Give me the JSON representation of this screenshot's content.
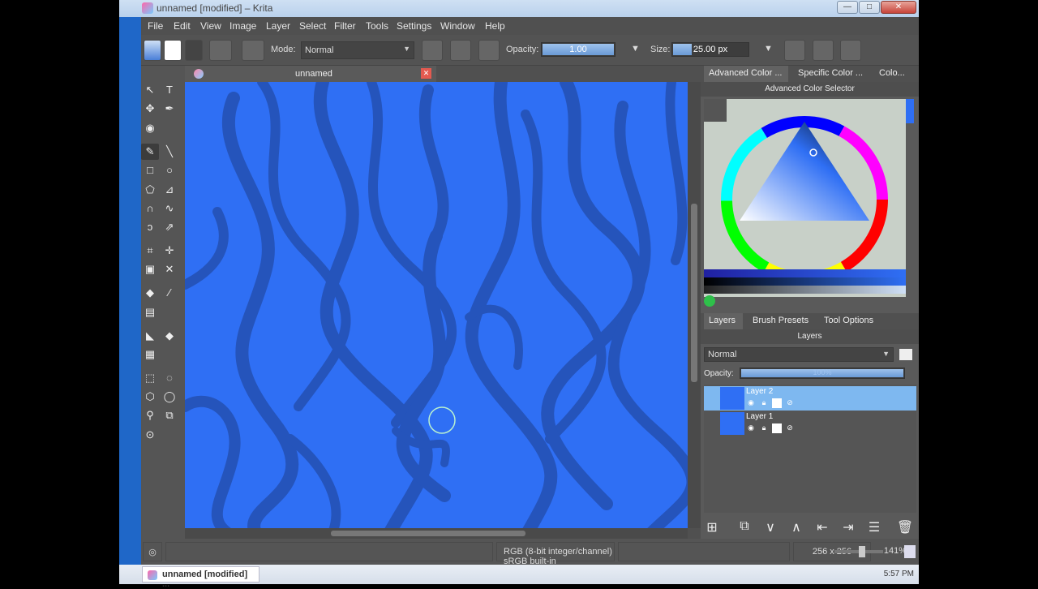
{
  "window": {
    "title": "unnamed [modified] – Krita",
    "minimize": "—",
    "maximize": "□",
    "close": "✕"
  },
  "menu": [
    "File",
    "Edit",
    "View",
    "Image",
    "Layer",
    "Select",
    "Filter",
    "Tools",
    "Settings",
    "Window",
    "Help"
  ],
  "toolbar": {
    "mode_label": "Mode:",
    "mode_value": "Normal",
    "opacity_label": "Opacity:",
    "opacity_value": "1.00",
    "opacity_fraction": 1.0,
    "size_label": "Size:",
    "size_value": "25.00 px",
    "size_fraction": 0.25
  },
  "document": {
    "tab_name": "unnamed",
    "close_glyph": "✕"
  },
  "dockers": {
    "color_tabs": [
      "Advanced Color ...",
      "Specific Color ...",
      "Colo..."
    ],
    "color_title": "Advanced Color Selector",
    "layer_tabs": [
      "Layers",
      "Brush Presets",
      "Tool Options"
    ],
    "layers_title": "Layers",
    "blend_mode": "Normal",
    "opacity_label": "Opacity:",
    "opacity_value": "100%",
    "layers": [
      {
        "name": "Layer 2",
        "selected": true
      },
      {
        "name": "Layer 1",
        "selected": false
      }
    ]
  },
  "status": {
    "colorspace": "RGB (8-bit integer/channel)  sRGB built-in",
    "dimensions": "256 x 256",
    "zoom": "141%"
  },
  "taskbar": {
    "task_label": "unnamed [modified] ...",
    "clock": "5:57 PM"
  },
  "colors": {
    "canvas_blue": "#2f6ff4",
    "stroke_blue": "#2553b8",
    "selection": "#7eb8f0",
    "accent": "#1f67c8"
  }
}
